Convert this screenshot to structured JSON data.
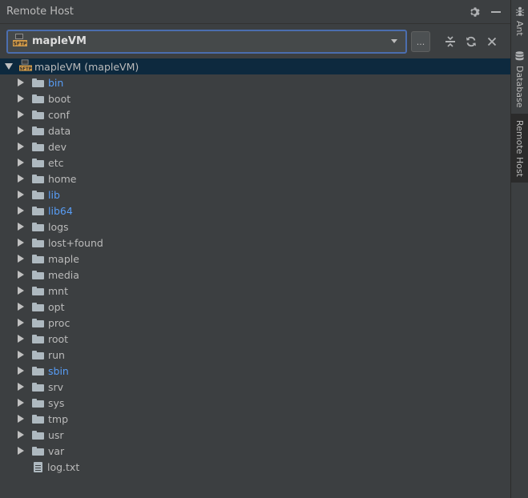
{
  "panel": {
    "title": "Remote Host",
    "host_combo": {
      "selected": "mapleVM"
    },
    "more_button": "...",
    "tree": {
      "root": "mapleVM (mapleVM)",
      "items": [
        {
          "name": "bin",
          "type": "folder",
          "link": true
        },
        {
          "name": "boot",
          "type": "folder",
          "link": false
        },
        {
          "name": "conf",
          "type": "folder",
          "link": false
        },
        {
          "name": "data",
          "type": "folder",
          "link": false
        },
        {
          "name": "dev",
          "type": "folder",
          "link": false
        },
        {
          "name": "etc",
          "type": "folder",
          "link": false
        },
        {
          "name": "home",
          "type": "folder",
          "link": false
        },
        {
          "name": "lib",
          "type": "folder",
          "link": true
        },
        {
          "name": "lib64",
          "type": "folder",
          "link": true
        },
        {
          "name": "logs",
          "type": "folder",
          "link": false
        },
        {
          "name": "lost+found",
          "type": "folder",
          "link": false
        },
        {
          "name": "maple",
          "type": "folder",
          "link": false
        },
        {
          "name": "media",
          "type": "folder",
          "link": false
        },
        {
          "name": "mnt",
          "type": "folder",
          "link": false
        },
        {
          "name": "opt",
          "type": "folder",
          "link": false
        },
        {
          "name": "proc",
          "type": "folder",
          "link": false
        },
        {
          "name": "root",
          "type": "folder",
          "link": false
        },
        {
          "name": "run",
          "type": "folder",
          "link": false
        },
        {
          "name": "sbin",
          "type": "folder",
          "link": true
        },
        {
          "name": "srv",
          "type": "folder",
          "link": false
        },
        {
          "name": "sys",
          "type": "folder",
          "link": false
        },
        {
          "name": "tmp",
          "type": "folder",
          "link": false
        },
        {
          "name": "usr",
          "type": "folder",
          "link": false
        },
        {
          "name": "var",
          "type": "folder",
          "link": false
        },
        {
          "name": "log.txt",
          "type": "file",
          "link": false
        }
      ]
    }
  },
  "sidebar": {
    "tabs": [
      {
        "label": "Ant",
        "icon": "ant-icon",
        "active": false
      },
      {
        "label": "Database",
        "icon": "database-icon",
        "active": false
      },
      {
        "label": "Remote Host",
        "icon": "",
        "active": true
      }
    ]
  },
  "colors": {
    "background": "#3c3f41",
    "selection": "#0d293e",
    "link": "#589df6",
    "focus_border": "#4b6eaf"
  }
}
